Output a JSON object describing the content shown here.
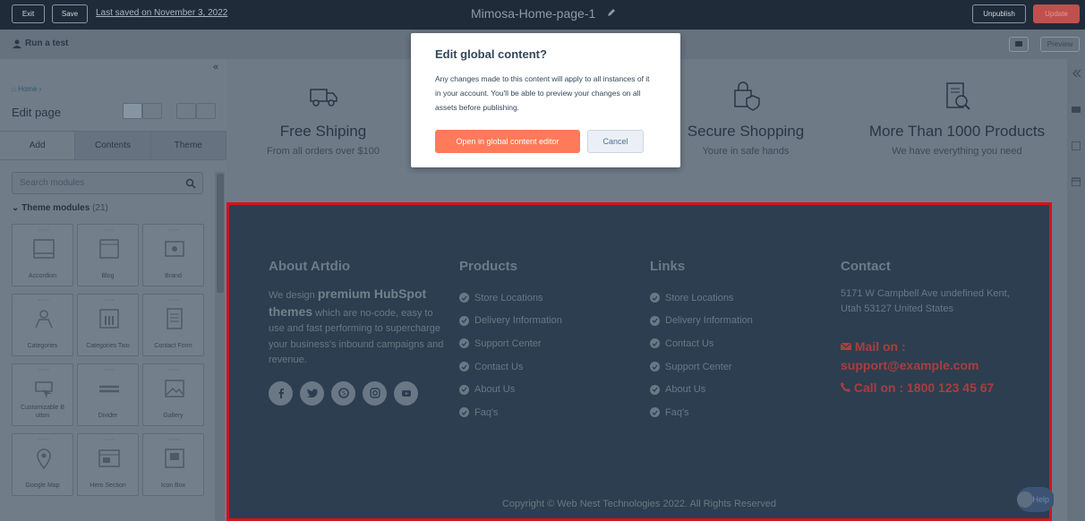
{
  "topbar": {
    "exit_label": "Exit",
    "save_label": "Save",
    "last_saved": "Last saved on November 3, 2022",
    "page_title": "Mimosa-Home-page-1",
    "unpublish_label": "Unpublish",
    "update_label": "Update"
  },
  "subbar": {
    "run_test": "Run a test",
    "preview_label": "Preview"
  },
  "sidebar": {
    "breadcrumb": "Home",
    "title": "Edit page",
    "tabs": [
      "Add",
      "Contents",
      "Theme"
    ],
    "search_placeholder": "Search modules",
    "section_title": "Theme modules",
    "section_count": "(21)",
    "modules": [
      "Accordion",
      "Blog",
      "Brand",
      "Categories",
      "Categories Two",
      "Contact Form",
      "Customizable B utton",
      "Divider",
      "Gallery",
      "Google Map",
      "Hero Section",
      "Icon Box"
    ]
  },
  "features": [
    {
      "title": "Free Shiping",
      "subtitle": "From all orders over $100",
      "icon": "truck-icon"
    },
    {
      "title": "Secure Shopping",
      "subtitle": "Youre in safe hands",
      "icon": "shield-bag-icon"
    },
    {
      "title": "More Than 1000 Products",
      "subtitle": "We have everything you need",
      "icon": "document-search-icon"
    }
  ],
  "footer": {
    "about_title": "About Artdio",
    "about_text_pre": "We design",
    "about_text_bold": "premium HubSpot themes",
    "about_text_post": "which are no-code, easy to use and fast performing to supercharge your business's inbound campaigns and revenue.",
    "products_title": "Products",
    "products": [
      "Store Locations",
      "Delivery Information",
      "Support Center",
      "Contact Us",
      "About Us",
      "Faq's"
    ],
    "links_title": "Links",
    "links": [
      "Store Locations",
      "Delivery Information",
      "Contact Us",
      "Support Center",
      "About Us",
      "Faq's"
    ],
    "contact_title": "Contact",
    "address": "5171 W Campbell Ave undefined Kent, Utah 53127 United States",
    "mail": "Mail on : support@example.com",
    "call": "Call on : 1800 123 45 67",
    "copyright": "Copyright © Web Nest Technologies 2022. All Rights Reserved",
    "help_label": "Help"
  },
  "modal": {
    "title": "Edit global content?",
    "body": "Any changes made to this content will apply to all instances of it in your account. You'll be able to preview your changes on all assets before publishing.",
    "primary_label": "Open in global content editor",
    "cancel_label": "Cancel"
  },
  "colors": {
    "accent": "#ff7a59",
    "footer_bg": "#2d3e50",
    "selection_border": "#d3131b"
  }
}
